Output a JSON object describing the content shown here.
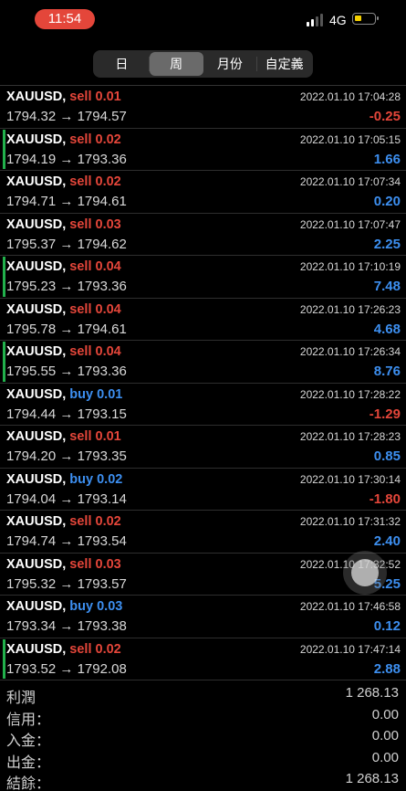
{
  "status_bar": {
    "time": "11:54",
    "network": "4G",
    "battery_level": 0.25
  },
  "segments": [
    {
      "label": "日",
      "active": false
    },
    {
      "label": "周",
      "active": true
    },
    {
      "label": "月份",
      "active": false
    },
    {
      "label": "自定義",
      "active": false
    }
  ],
  "orders": [
    {
      "symbol": "XAUUSD,",
      "side": "sell",
      "volume": "0.01",
      "datetime": "2022.01.10 17:04:28",
      "open": "1794.32",
      "close": "1794.57",
      "profit": "-0.25",
      "marker": false
    },
    {
      "symbol": "XAUUSD,",
      "side": "sell",
      "volume": "0.02",
      "datetime": "2022.01.10 17:05:15",
      "open": "1794.19",
      "close": "1793.36",
      "profit": "1.66",
      "marker": true
    },
    {
      "symbol": "XAUUSD,",
      "side": "sell",
      "volume": "0.02",
      "datetime": "2022.01.10 17:07:34",
      "open": "1794.71",
      "close": "1794.61",
      "profit": "0.20",
      "marker": false
    },
    {
      "symbol": "XAUUSD,",
      "side": "sell",
      "volume": "0.03",
      "datetime": "2022.01.10 17:07:47",
      "open": "1795.37",
      "close": "1794.62",
      "profit": "2.25",
      "marker": false
    },
    {
      "symbol": "XAUUSD,",
      "side": "sell",
      "volume": "0.04",
      "datetime": "2022.01.10 17:10:19",
      "open": "1795.23",
      "close": "1793.36",
      "profit": "7.48",
      "marker": true
    },
    {
      "symbol": "XAUUSD,",
      "side": "sell",
      "volume": "0.04",
      "datetime": "2022.01.10 17:26:23",
      "open": "1795.78",
      "close": "1794.61",
      "profit": "4.68",
      "marker": false
    },
    {
      "symbol": "XAUUSD,",
      "side": "sell",
      "volume": "0.04",
      "datetime": "2022.01.10 17:26:34",
      "open": "1795.55",
      "close": "1793.36",
      "profit": "8.76",
      "marker": true
    },
    {
      "symbol": "XAUUSD,",
      "side": "buy",
      "volume": "0.01",
      "datetime": "2022.01.10 17:28:22",
      "open": "1794.44",
      "close": "1793.15",
      "profit": "-1.29",
      "marker": false
    },
    {
      "symbol": "XAUUSD,",
      "side": "sell",
      "volume": "0.01",
      "datetime": "2022.01.10 17:28:23",
      "open": "1794.20",
      "close": "1793.35",
      "profit": "0.85",
      "marker": false
    },
    {
      "symbol": "XAUUSD,",
      "side": "buy",
      "volume": "0.02",
      "datetime": "2022.01.10 17:30:14",
      "open": "1794.04",
      "close": "1793.14",
      "profit": "-1.80",
      "marker": false
    },
    {
      "symbol": "XAUUSD,",
      "side": "sell",
      "volume": "0.02",
      "datetime": "2022.01.10 17:31:32",
      "open": "1794.74",
      "close": "1793.54",
      "profit": "2.40",
      "marker": false
    },
    {
      "symbol": "XAUUSD,",
      "side": "sell",
      "volume": "0.03",
      "datetime": "2022.01.10 17:32:52",
      "open": "1795.32",
      "close": "1793.57",
      "profit": "5.25",
      "marker": false
    },
    {
      "symbol": "XAUUSD,",
      "side": "buy",
      "volume": "0.03",
      "datetime": "2022.01.10 17:46:58",
      "open": "1793.34",
      "close": "1793.38",
      "profit": "0.12",
      "marker": false
    },
    {
      "symbol": "XAUUSD,",
      "side": "sell",
      "volume": "0.02",
      "datetime": "2022.01.10 17:47:14",
      "open": "1793.52",
      "close": "1792.08",
      "profit": "2.88",
      "marker": true
    }
  ],
  "arrow": "→",
  "summary": [
    {
      "label": "利潤",
      "value": "1 268.13"
    },
    {
      "label": "信用：",
      "value": "0.00"
    },
    {
      "label": "入金：",
      "value": "0.00"
    },
    {
      "label": "出金：",
      "value": "0.00"
    },
    {
      "label": "結餘：",
      "value": "1 268.13"
    }
  ],
  "colors": {
    "sell": "#e4463a",
    "buy": "#3d8ff0",
    "profit_positive": "#3d8ff0",
    "profit_negative": "#e4463a",
    "marker": "#22b14c"
  }
}
